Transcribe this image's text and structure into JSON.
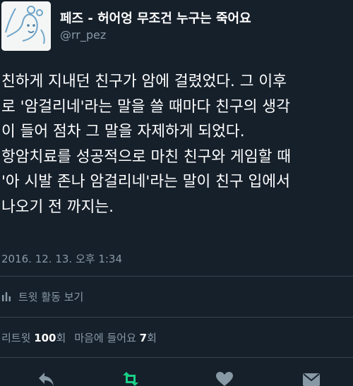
{
  "header": {
    "display_name": "페즈 - 허어엉 무조건 누구는 죽어요",
    "handle": "@rr_pez"
  },
  "tweet": {
    "lines": [
      "친하게 지내던 친구가 암에 걸렸었다. 그 이후",
      "로 '암걸리네'라는 말을 쓸 때마다 친구의 생각",
      "이 들어 점차 그 말을 자제하게 되었다.",
      "항암치료를 성공적으로 마친 친구와 게임할 때",
      "'아 시발 존나 암걸리네'라는 말이 친구 입에서",
      "나오기 전 까지는."
    ],
    "timestamp": "2016. 12. 13. 오후 1:34"
  },
  "activity": {
    "label": "트윗 활동 보기",
    "icon": "bar-chart-icon"
  },
  "stats": {
    "retweets_label": "리트윗",
    "retweets_count": "100",
    "retweets_unit": "회",
    "likes_label": "마음에 들어요",
    "likes_count": "7",
    "likes_unit": "회"
  },
  "actions": [
    {
      "name": "reply",
      "icon": "reply-icon"
    },
    {
      "name": "retweet",
      "icon": "retweet-icon"
    },
    {
      "name": "like",
      "icon": "heart-icon"
    },
    {
      "name": "message",
      "icon": "envelope-icon"
    }
  ],
  "colors": {
    "background": "#16202b",
    "text": "#ffffff",
    "muted": "#8899a6",
    "divider": "#38444d",
    "retweet_active": "#19cf86"
  }
}
